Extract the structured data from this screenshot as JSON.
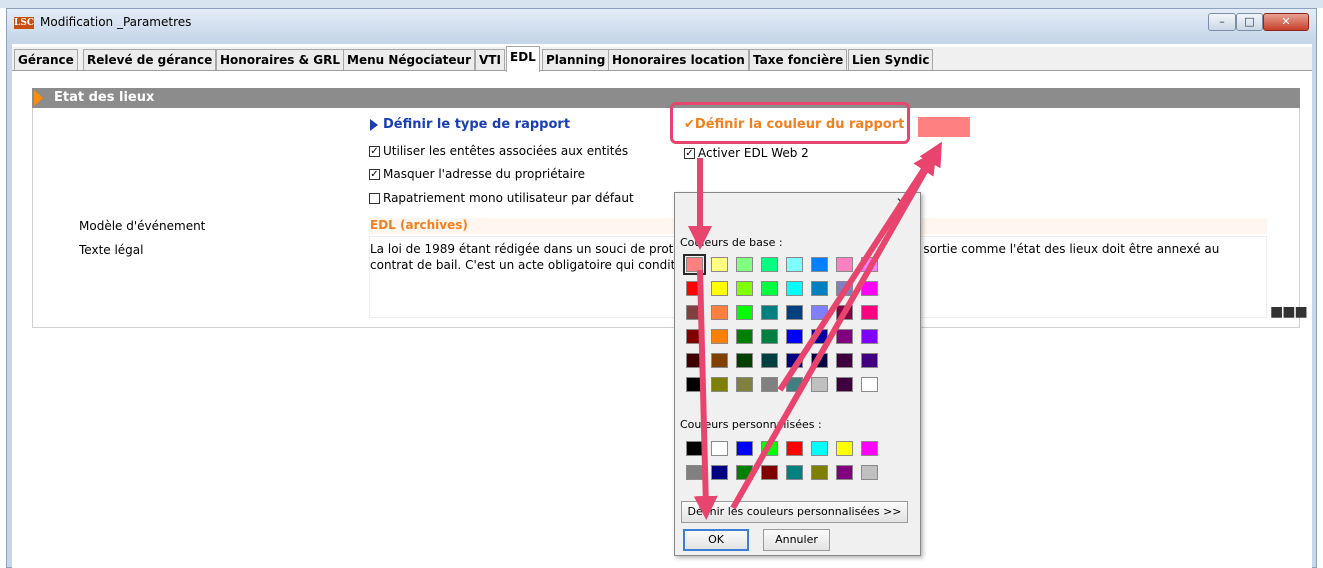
{
  "window": {
    "icon_text": "LSC",
    "title": "Modification _Parametres",
    "controls": {
      "minimize": "–",
      "maximize": "□",
      "close": "✕"
    }
  },
  "tabs": [
    {
      "label": "Gérance",
      "active": false
    },
    {
      "label": "Relevé de gérance",
      "active": false
    },
    {
      "label": "Honoraires & GRL",
      "active": false
    },
    {
      "label": "Menu Négociateur",
      "active": false
    },
    {
      "label": "VTI",
      "active": false
    },
    {
      "label": "EDL",
      "active": true
    },
    {
      "label": "Planning",
      "active": false
    },
    {
      "label": "Honoraires location",
      "active": false
    },
    {
      "label": "Taxe foncière",
      "active": false
    },
    {
      "label": "Lien Syndic",
      "active": false
    }
  ],
  "section": {
    "title": "Etat des lieux",
    "type_heading": "Définir le type de rapport",
    "color_heading": "Définir la couleur du rapport",
    "color_value": "#ff8080",
    "checkboxes": [
      {
        "label": "Utiliser les entêtes associées aux entités",
        "checked": true
      },
      {
        "label": "Masquer l'adresse du propriétaire",
        "checked": true
      },
      {
        "label": "Rapatriement mono utilisateur par défaut",
        "checked": false
      },
      {
        "label": "Activer EDL Web 2",
        "checked": true
      }
    ],
    "modele_label": "Modèle d'événement",
    "modele_value": "EDL (archives)",
    "texte_label": "Texte légal",
    "texte_value": "La loi de 1989 étant rédigée dans un souci de protection du locataire, l'état des lieux dit de sortie comme l'état des lieux doit être annexé au contrat de bail. C'est un acte obligatoire qui conditionne la remise des clés.",
    "more_button": "■■■"
  },
  "color_dialog": {
    "close_glyph": "✕",
    "basic_label": "Couleurs de base :",
    "custom_label": "Couleurs personnalisées :",
    "basic_colors": [
      [
        "#ff8080",
        "#ffff80",
        "#80ff80",
        "#00ff80",
        "#80ffff",
        "#0080ff",
        "#ff80c0",
        "#ff80ff"
      ],
      [
        "#ff0000",
        "#ffff00",
        "#80ff00",
        "#00ff40",
        "#00ffff",
        "#0080c0",
        "#8080c0",
        "#ff00ff"
      ],
      [
        "#804040",
        "#ff8040",
        "#00ff00",
        "#008080",
        "#004080",
        "#8080ff",
        "#800040",
        "#ff0080"
      ],
      [
        "#800000",
        "#ff8000",
        "#008000",
        "#008040",
        "#0000ff",
        "#0000a0",
        "#800080",
        "#8000ff"
      ],
      [
        "#400000",
        "#804000",
        "#004000",
        "#004040",
        "#000080",
        "#000040",
        "#400040",
        "#400080"
      ],
      [
        "#000000",
        "#808000",
        "#808040",
        "#808080",
        "#408080",
        "#c0c0c0",
        "#400040",
        "#ffffff"
      ]
    ],
    "custom_colors": [
      [
        "#000000",
        "#ffffff",
        "#0000ff",
        "#00ff00",
        "#ff0000",
        "#00ffff",
        "#ffff00",
        "#ff00ff"
      ],
      [
        "#808080",
        "#000080",
        "#008000",
        "#800000",
        "#008080",
        "#808000",
        "#800080",
        "#c0c0c0"
      ]
    ],
    "selected_basic": "#ff8080",
    "define_button": "Définir les couleurs personnalisées >>",
    "ok_button": "OK",
    "cancel_button": "Annuler"
  },
  "colors": {
    "accent_orange": "#f08020",
    "heading_blue": "#1a3fb5",
    "annotation_pink": "#e8456e",
    "section_header": "#8c8c8c"
  }
}
